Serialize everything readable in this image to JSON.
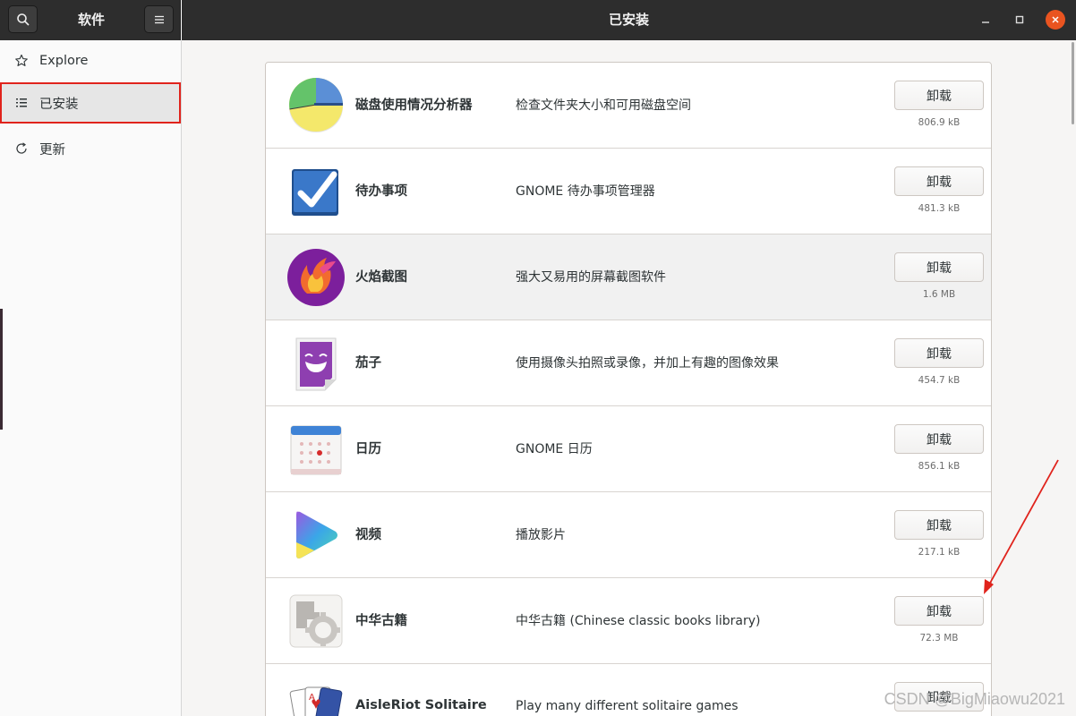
{
  "sidebar": {
    "title": "软件",
    "items": [
      {
        "label": "Explore",
        "icon": "star-icon"
      },
      {
        "label": "已安装",
        "icon": "list-icon"
      },
      {
        "label": "更新",
        "icon": "refresh-icon"
      }
    ]
  },
  "header": {
    "title": "已安装"
  },
  "apps": [
    {
      "name": "磁盘使用情况分析器",
      "description": "检查文件夹大小和可用磁盘空间",
      "button": "卸载",
      "size": "806.9 kB"
    },
    {
      "name": "待办事项",
      "description": "GNOME 待办事项管理器",
      "button": "卸载",
      "size": "481.3 kB"
    },
    {
      "name": "火焰截图",
      "description": "强大又易用的屏幕截图软件",
      "button": "卸载",
      "size": "1.6 MB"
    },
    {
      "name": "茄子",
      "description": "使用摄像头拍照或录像，并加上有趣的图像效果",
      "button": "卸载",
      "size": "454.7 kB"
    },
    {
      "name": "日历",
      "description": "GNOME 日历",
      "button": "卸载",
      "size": "856.1 kB"
    },
    {
      "name": "视频",
      "description": "播放影片",
      "button": "卸载",
      "size": "217.1 kB"
    },
    {
      "name": "中华古籍",
      "description": "中华古籍 (Chinese classic books library)",
      "button": "卸载",
      "size": "72.3 MB"
    },
    {
      "name": "AisleRiot Solitaire",
      "description": "Play many different solitaire games",
      "button": "卸载",
      "size": ""
    }
  ],
  "watermark": "CSDN @BigMiaowu2021",
  "colors": {
    "header_bg": "#2d2d2d",
    "close_button": "#e95420",
    "selection_outline": "#e0231c",
    "annotation_arrow": "#e0231c"
  }
}
